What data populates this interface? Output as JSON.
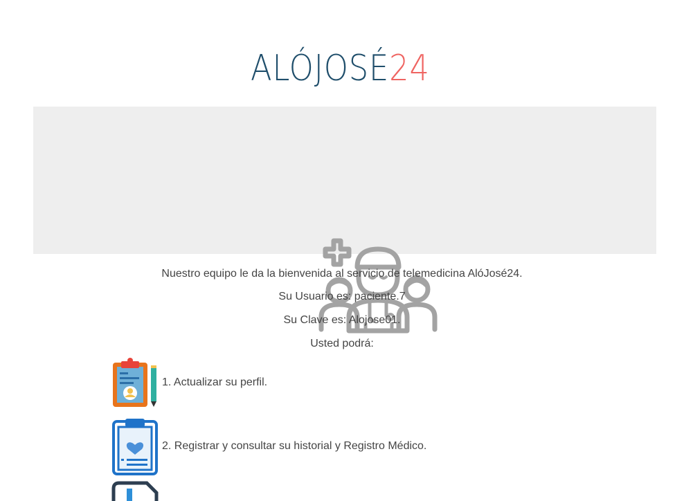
{
  "logo": {
    "main_text": "ALÓJOSÉ",
    "number_text": "24",
    "colors": {
      "main": "#1f4e6b",
      "accent": "#ef6461"
    },
    "icon": "stethoscope-phone-icon"
  },
  "banner": {
    "background": "#eeeeee",
    "illustration": "medical-team-icon"
  },
  "welcome": {
    "line1": "Nuestro equipo le da la bienvenida al servicio de telemedicina AlóJosé24.",
    "user_line": "Su Usuario es: paciente.7",
    "password_line": "Su Clave es: Alojose01.",
    "can_line": "Usted podrá:"
  },
  "features": [
    {
      "icon": "profile-clipboard-icon",
      "label": "1. Actualizar su perfil."
    },
    {
      "icon": "medical-record-clipboard-icon",
      "label": "2. Registrar y consultar su historial y Registro Médico."
    },
    {
      "icon": "document-icon",
      "label": ""
    }
  ]
}
